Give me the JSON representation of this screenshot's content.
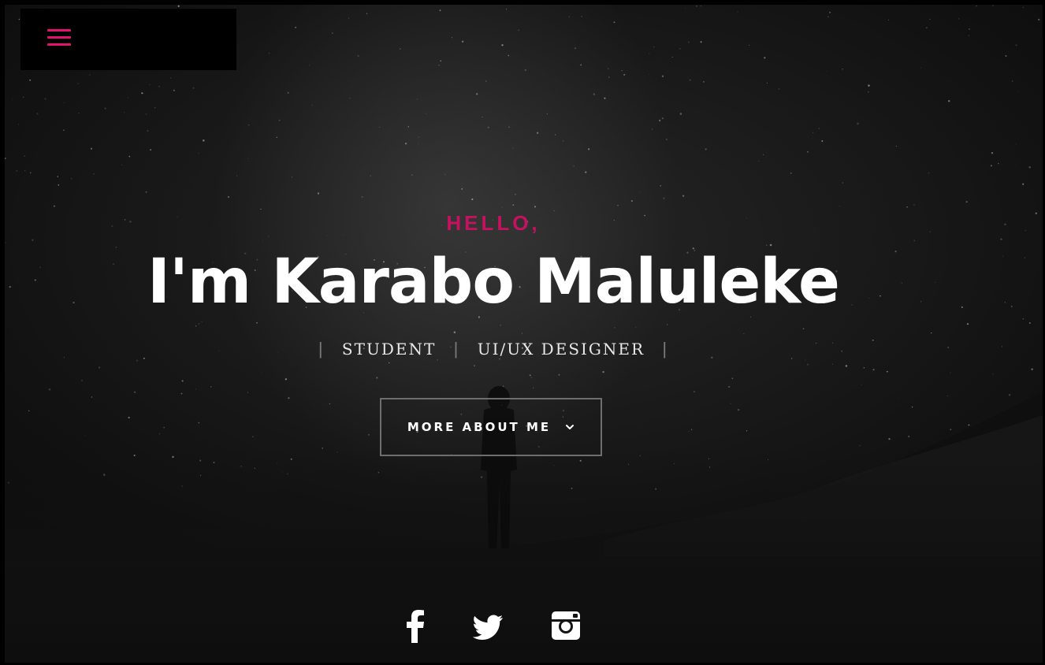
{
  "menu": {
    "icon": "hamburger-menu-icon",
    "color": "#e0136d"
  },
  "hero": {
    "greeting": "HELLO,",
    "name": "I'm Karabo Maluleke",
    "roles": [
      "STUDENT",
      "UI/UX DESIGNER"
    ],
    "separator": "|",
    "cta_label": "MORE ABOUT ME",
    "cta_icon": "chevron-down-icon"
  },
  "social": [
    {
      "name": "facebook",
      "icon": "facebook-icon"
    },
    {
      "name": "twitter",
      "icon": "twitter-icon"
    },
    {
      "name": "instagram",
      "icon": "instagram-icon"
    }
  ],
  "colors": {
    "accent": "#c5115f",
    "background": "#141414",
    "text": "#ffffff"
  }
}
